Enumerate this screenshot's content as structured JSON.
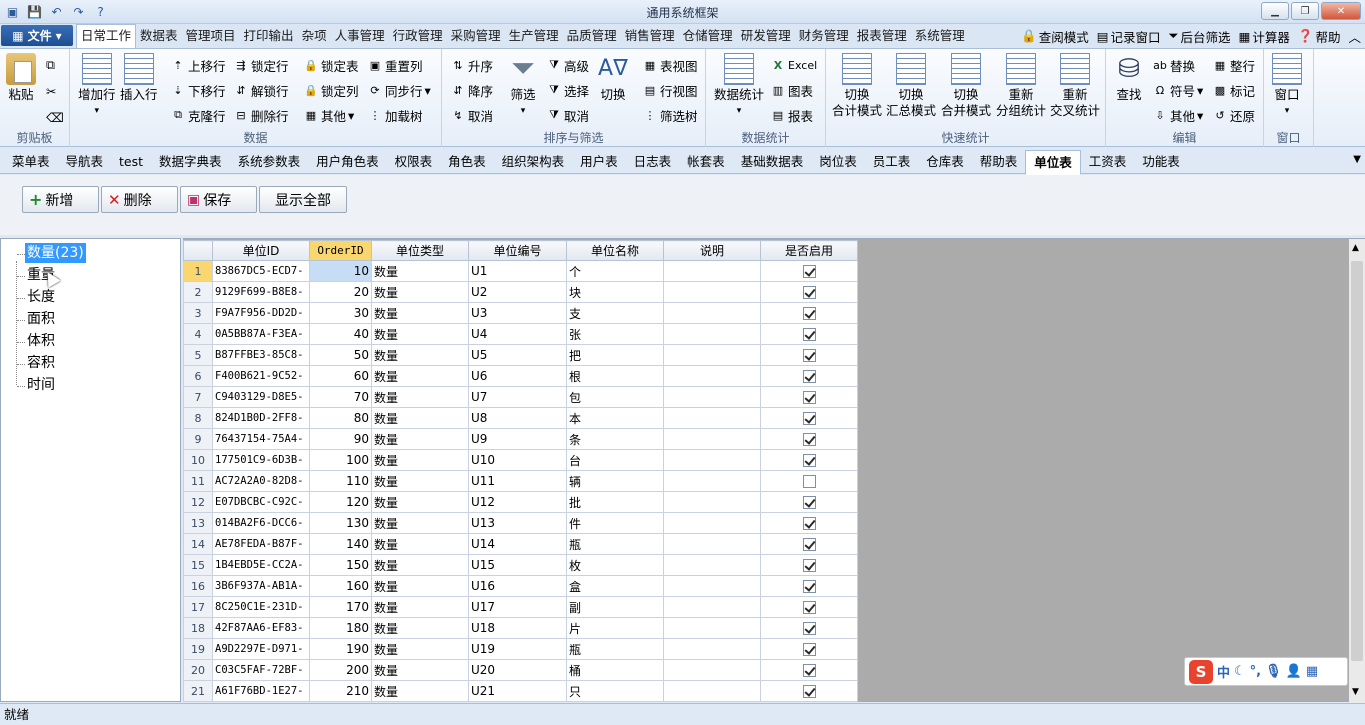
{
  "window": {
    "title": "通用系统框架"
  },
  "file_menu": {
    "label": "文件"
  },
  "menus": [
    "日常工作",
    "数据表",
    "管理项目",
    "打印输出",
    "杂项",
    "人事管理",
    "行政管理",
    "采购管理",
    "生产管理",
    "品质管理",
    "销售管理",
    "仓储管理",
    "研发管理",
    "财务管理",
    "报表管理",
    "系统管理"
  ],
  "right_menu": [
    "查阅模式",
    "记录窗口",
    "后台筛选",
    "计算器",
    "帮助"
  ],
  "ribbon": {
    "clipboard": {
      "label": "剪贴板",
      "paste": "粘贴"
    },
    "data": {
      "label": "数据",
      "add_row": "增加行",
      "insert_row": "插入行",
      "move_up": "上移行",
      "move_down": "下移行",
      "clone_row": "克隆行",
      "lock_row": "锁定行",
      "unlock_row": "解锁行",
      "delete_row": "删除行",
      "lock_table": "锁定表",
      "lock_col": "锁定列",
      "other": "其他",
      "reset_col": "重置列",
      "sync_row": "同步行",
      "load_tree": "加载树"
    },
    "sort": {
      "label": "排序与筛选",
      "asc": "升序",
      "desc": "降序",
      "cancel_sort": "取消",
      "filter": "筛选",
      "advanced": "高级",
      "select": "选择",
      "cancel_filter": "取消",
      "switch": "切换",
      "table_view": "表视图",
      "row_view": "行视图",
      "filter_tree": "筛选树"
    },
    "stats": {
      "label": "数据统计",
      "data_stats": "数据统计",
      "excel": "Excel",
      "chart": "图表",
      "report": "报表"
    },
    "quick": {
      "label": "快速统计",
      "b1": [
        "切换",
        "合计模式"
      ],
      "b2": [
        "切换",
        "汇总模式"
      ],
      "b3": [
        "切换",
        "合并模式"
      ],
      "b4": [
        "重新",
        "分组统计"
      ],
      "b5": [
        "重新",
        "交叉统计"
      ]
    },
    "edit": {
      "label": "编辑",
      "find": "查找",
      "replace": "替换",
      "symbol": "符号",
      "other": "其他",
      "tidy": "整行",
      "mark": "标记",
      "restore": "还原"
    },
    "window": {
      "label": "窗口",
      "window": "窗口"
    }
  },
  "tabs": [
    "菜单表",
    "导航表",
    "test",
    "数据字典表",
    "系统参数表",
    "用户角色表",
    "权限表",
    "角色表",
    "组织架构表",
    "用户表",
    "日志表",
    "帐套表",
    "基础数据表",
    "岗位表",
    "员工表",
    "仓库表",
    "帮助表",
    "单位表",
    "工资表",
    "功能表"
  ],
  "active_tab": "单位表",
  "toolbar": {
    "add": "新增",
    "delete": "删除",
    "save": "保存",
    "show_all": "显示全部"
  },
  "tree": {
    "items": [
      "数量(23)",
      "重量",
      "长度",
      "面积",
      "体积",
      "容积",
      "时间"
    ]
  },
  "grid": {
    "columns": [
      "单位ID",
      "OrderID",
      "单位类型",
      "单位编号",
      "单位名称",
      "说明",
      "是否启用"
    ],
    "rows": [
      [
        "1",
        "83867DC5-ECD7-",
        "10",
        "数量",
        "U1",
        "个",
        "",
        true
      ],
      [
        "2",
        "9129F699-B8E8-",
        "20",
        "数量",
        "U2",
        "块",
        "",
        true
      ],
      [
        "3",
        "F9A7F956-DD2D-",
        "30",
        "数量",
        "U3",
        "支",
        "",
        true
      ],
      [
        "4",
        "0A5BB87A-F3EA-",
        "40",
        "数量",
        "U4",
        "张",
        "",
        true
      ],
      [
        "5",
        "B87FFBE3-85C8-",
        "50",
        "数量",
        "U5",
        "把",
        "",
        true
      ],
      [
        "6",
        "F400B621-9C52-",
        "60",
        "数量",
        "U6",
        "根",
        "",
        true
      ],
      [
        "7",
        "C9403129-D8E5-",
        "70",
        "数量",
        "U7",
        "包",
        "",
        true
      ],
      [
        "8",
        "824D1B0D-2FF8-",
        "80",
        "数量",
        "U8",
        "本",
        "",
        true
      ],
      [
        "9",
        "76437154-75A4-",
        "90",
        "数量",
        "U9",
        "条",
        "",
        true
      ],
      [
        "10",
        "177501C9-6D3B-",
        "100",
        "数量",
        "U10",
        "台",
        "",
        true
      ],
      [
        "11",
        "AC72A2A0-82D8-",
        "110",
        "数量",
        "U11",
        "辆",
        "",
        false
      ],
      [
        "12",
        "E07DBCBC-C92C-",
        "120",
        "数量",
        "U12",
        "批",
        "",
        true
      ],
      [
        "13",
        "014BA2F6-DCC6-",
        "130",
        "数量",
        "U13",
        "件",
        "",
        true
      ],
      [
        "14",
        "AE78FEDA-B87F-",
        "140",
        "数量",
        "U14",
        "瓶",
        "",
        true
      ],
      [
        "15",
        "1B4EBD5E-CC2A-",
        "150",
        "数量",
        "U15",
        "枚",
        "",
        true
      ],
      [
        "16",
        "3B6F937A-AB1A-",
        "160",
        "数量",
        "U16",
        "盒",
        "",
        true
      ],
      [
        "17",
        "8C250C1E-231D-",
        "170",
        "数量",
        "U17",
        "副",
        "",
        true
      ],
      [
        "18",
        "42F87AA6-EF83-",
        "180",
        "数量",
        "U18",
        "片",
        "",
        true
      ],
      [
        "19",
        "A9D2297E-D971-",
        "190",
        "数量",
        "U19",
        "瓶",
        "",
        true
      ],
      [
        "20",
        "C03C5FAF-72BF-",
        "200",
        "数量",
        "U20",
        "桶",
        "",
        true
      ],
      [
        "21",
        "A61F76BD-1E27-",
        "210",
        "数量",
        "U21",
        "只",
        "",
        true
      ]
    ]
  },
  "statusbar": {
    "text": "就绪"
  },
  "ime": {
    "logo": "S",
    "mode": "中"
  }
}
